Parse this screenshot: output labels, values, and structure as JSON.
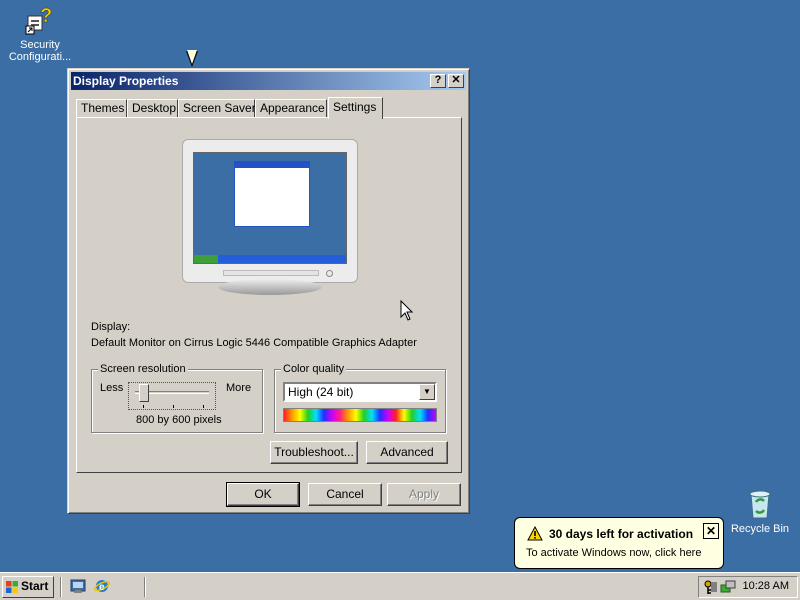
{
  "desktop": {
    "icons": [
      {
        "label": "Security Configurati...",
        "icon": "security-config-icon"
      },
      {
        "label": "Recycle Bin",
        "icon": "recycle-bin-icon"
      }
    ]
  },
  "window": {
    "title": "Display Properties",
    "help_button": "?",
    "close_button": "✕",
    "tabs": [
      {
        "label": "Themes"
      },
      {
        "label": "Desktop"
      },
      {
        "label": "Screen Saver"
      },
      {
        "label": "Appearance"
      },
      {
        "label": "Settings",
        "active": true
      }
    ],
    "display_label": "Display:",
    "display_device": "Default Monitor on Cirrus Logic 5446 Compatible Graphics Adapter",
    "screen_resolution": {
      "title": "Screen resolution",
      "less": "Less",
      "more": "More",
      "value_text": "800 by 600 pixels",
      "slider_position": 0
    },
    "color_quality": {
      "title": "Color quality",
      "selected": "High (24 bit)"
    },
    "buttons": {
      "troubleshoot": "Troubleshoot...",
      "advanced": "Advanced",
      "ok": "OK",
      "cancel": "Cancel",
      "apply": "Apply"
    }
  },
  "taskbar": {
    "start_label": "Start",
    "clock": "10:28 AM"
  },
  "balloon": {
    "title": "30 days left for activation",
    "text": "To activate Windows now, click here",
    "close": "✕"
  }
}
